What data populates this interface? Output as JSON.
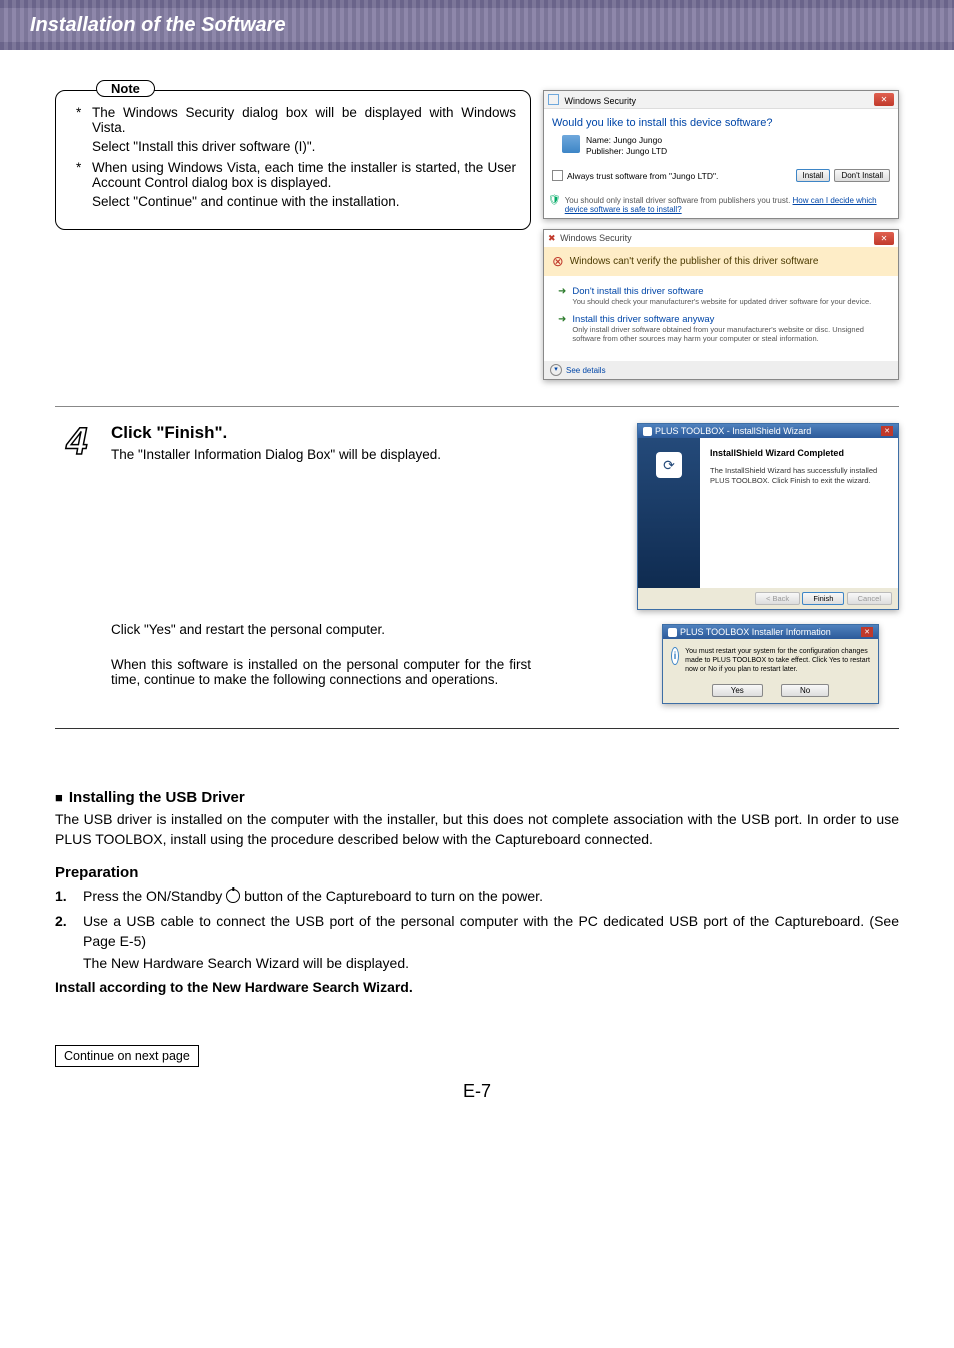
{
  "header": {
    "title": "Installation of the Software"
  },
  "note": {
    "label": "Note",
    "item1_prefix": "*",
    "item1": "The Windows Security dialog box will be displayed with Windows Vista.",
    "item1_sub": "Select \"Install this driver software (I)\".",
    "item2_prefix": "*",
    "item2": "When using Windows Vista, each time the installer is started, the User Account Control dialog box is displayed.",
    "item2_sub": "Select \"Continue\" and continue with the installation."
  },
  "ws1": {
    "title": "Windows Security",
    "heading": "Would you like to install this device software?",
    "name": "Name: Jungo Jungo",
    "publisher": "Publisher: Jungo LTD",
    "trust": "Always trust software from \"Jungo LTD\".",
    "install": "Install",
    "dont_install": "Don't Install",
    "foot_text": "You should only install driver software from publishers you trust.",
    "foot_link": "How can I decide which device software is safe to install?"
  },
  "ws2": {
    "title": "Windows Security",
    "banner": "Windows can't verify the publisher of this driver software",
    "opt1_title": "Don't install this driver software",
    "opt1_sub": "You should check your manufacturer's website for updated driver software for your device.",
    "opt2_title": "Install this driver software anyway",
    "opt2_sub": "Only install driver software obtained from your manufacturer's website or disc. Unsigned software from other sources may harm your computer or steal information.",
    "see_details": "See details"
  },
  "step4": {
    "num": "4",
    "heading": "Click \"Finish\".",
    "sub": "The \"Installer Information Dialog Box\" will be displayed.",
    "p1": "Click \"Yes\" and restart the personal computer.",
    "p2": "When this software is installed on the personal computer for the first time, continue to make the following connections and operations."
  },
  "is": {
    "title": "PLUS TOOLBOX - InstallShield Wizard",
    "h": "InstallShield Wizard Completed",
    "txt": "The InstallShield Wizard has successfully installed PLUS TOOLBOX. Click Finish to exit the wizard.",
    "back": "< Back",
    "finish": "Finish",
    "cancel": "Cancel"
  },
  "ii": {
    "title": "PLUS TOOLBOX Installer Information",
    "txt": "You must restart your system for the configuration changes made to PLUS TOOLBOX to take effect. Click Yes to restart now or No if you plan to restart later.",
    "yes": "Yes",
    "no": "No"
  },
  "usb": {
    "heading": "Installing the USB Driver",
    "para": "The USB driver is installed on the computer with the installer, but this does not complete association with the USB port. In order to use PLUS TOOLBOX, install using the procedure described below with the Captureboard connected.",
    "prep": "Preparation",
    "s1_num": "1.",
    "s1_a": "Press the ON/Standby ",
    "s1_b": " button of the Captureboard to turn on the power.",
    "s2_num": "2.",
    "s2": "Use a USB cable to connect the USB port of the personal computer with the PC dedicated USB port of the Captureboard. (See Page E-5)",
    "s2_sub": "The New Hardware Search Wizard will be displayed.",
    "inst": "Install according to the New Hardware Search Wizard."
  },
  "footer": {
    "continue": "Continue on next page",
    "page": "E-7"
  }
}
